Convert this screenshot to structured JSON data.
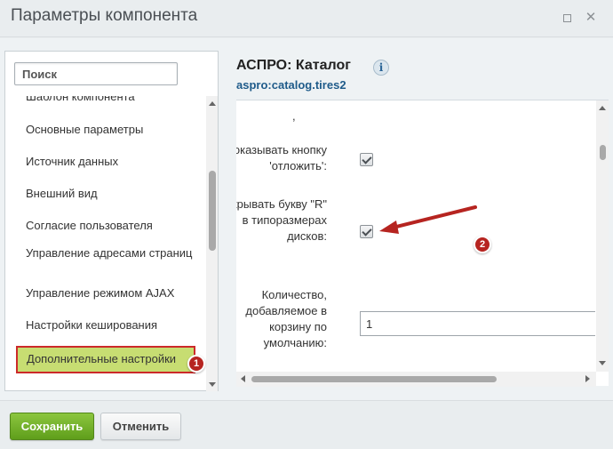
{
  "window": {
    "title": "Параметры компонента"
  },
  "sidebar": {
    "search_placeholder": "Поиск",
    "items": [
      {
        "label": "Шаблон компонента"
      },
      {
        "label": "Основные параметры"
      },
      {
        "label": "Источник данных"
      },
      {
        "label": "Внешний вид"
      },
      {
        "label": "Согласие пользователя"
      },
      {
        "label": "Управление адресами страниц"
      },
      {
        "label": "Управление режимом AJAX"
      },
      {
        "label": "Настройки кеширования"
      },
      {
        "label": "Дополнительные настройки",
        "active": true
      }
    ],
    "scroll_position": 0.5
  },
  "component": {
    "title": "АСПРО: Каталог",
    "code": "aspro:catalog.tires2",
    "info_icon": "info-icon"
  },
  "params": {
    "dot_label": ",",
    "show_delay_label": "Показывать кнопку 'отложить':",
    "show_delay_checked": true,
    "hide_r_label": "Скрывать букву \"R\" в типоразмерах дисков:",
    "hide_r_checked": true,
    "qty_label": "Количество, добавляемое в корзину по умолчанию:",
    "qty_value": "1"
  },
  "annotations": {
    "badge1": "1",
    "badge2": "2",
    "color": "#b62420"
  },
  "footer": {
    "save_label": "Сохранить",
    "cancel_label": "Отменить"
  },
  "colors": {
    "active_item_bg": "#c7dd72",
    "highlight_border": "#cc2a2a",
    "save_button": "#6aaa22",
    "link_blue": "#1f5b8a"
  }
}
